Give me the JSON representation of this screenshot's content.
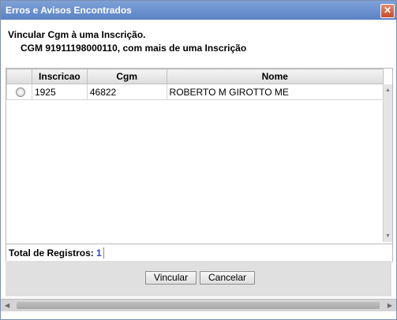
{
  "window": {
    "title": "Erros e Avisos Encontrados",
    "close_glyph": "✕"
  },
  "message": {
    "line1": "Vincular Cgm à uma Inscrição.",
    "line2": "CGM 91911198000110, com mais de uma Inscrição"
  },
  "grid": {
    "columns": [
      "Inscricao",
      "Cgm",
      "Nome"
    ],
    "rows": [
      {
        "inscricao": "1925",
        "cgm": "46822",
        "nome": "ROBERTO M GIROTTO ME",
        "selected": false
      }
    ]
  },
  "footer": {
    "total_label": "Total de Registros:",
    "total_value": "1"
  },
  "buttons": {
    "vincular": "Vincular",
    "cancelar": "Cancelar"
  },
  "icons": {
    "close": "close-icon",
    "radio": "radio-icon",
    "scroll_up": "arrow-up-icon",
    "scroll_down": "arrow-down-icon",
    "scroll_left": "arrow-left-icon",
    "scroll_right": "arrow-right-icon"
  }
}
